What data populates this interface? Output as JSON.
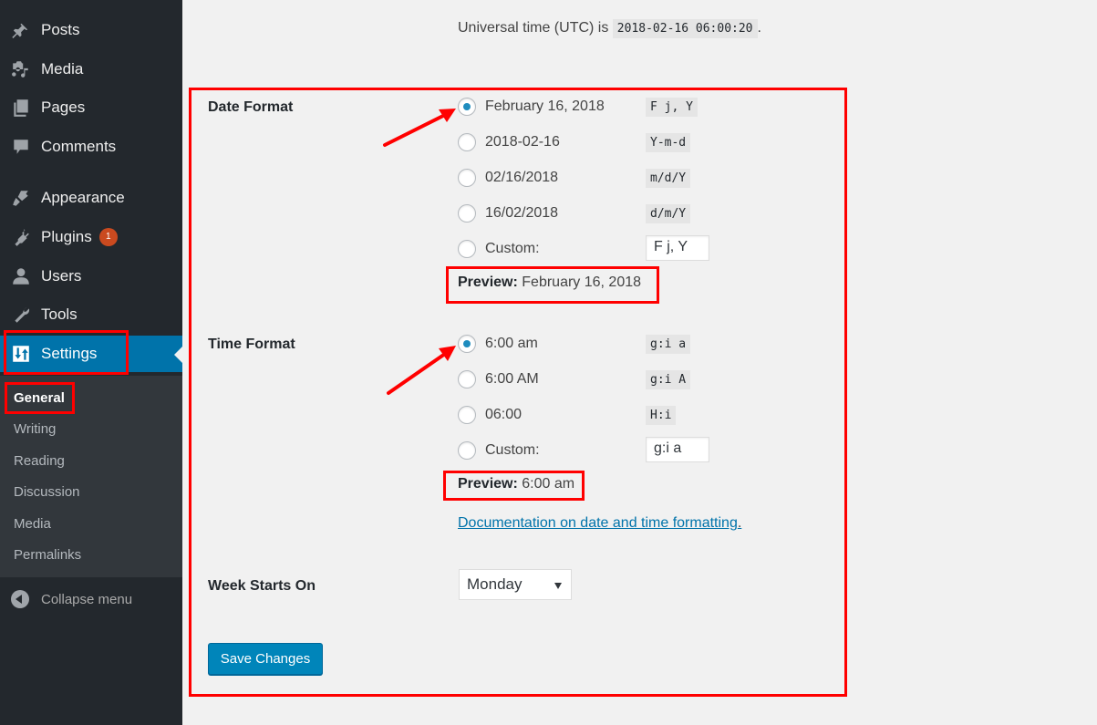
{
  "sidebar": {
    "items": [
      {
        "label": "Posts",
        "icon": "pushpin-icon"
      },
      {
        "label": "Media",
        "icon": "media-icon"
      },
      {
        "label": "Pages",
        "icon": "pages-icon"
      },
      {
        "label": "Comments",
        "icon": "comment-icon"
      },
      {
        "label": "Appearance",
        "icon": "paintbrush-icon"
      },
      {
        "label": "Plugins",
        "icon": "plugin-icon",
        "badge": "1"
      },
      {
        "label": "Users",
        "icon": "user-icon"
      },
      {
        "label": "Tools",
        "icon": "wrench-icon"
      },
      {
        "label": "Settings",
        "icon": "settings-icon",
        "active": true
      }
    ],
    "submenu": [
      "General",
      "Writing",
      "Reading",
      "Discussion",
      "Media",
      "Permalinks"
    ],
    "current_submenu": "General",
    "collapse_label": "Collapse menu"
  },
  "utc": {
    "label": "Universal time (UTC) is",
    "value": "2018-02-16 06:00:20",
    "suffix": "."
  },
  "date_format": {
    "label": "Date Format",
    "options": [
      {
        "label": "February 16, 2018",
        "format": "F j, Y",
        "checked": true
      },
      {
        "label": "2018-02-16",
        "format": "Y-m-d"
      },
      {
        "label": "02/16/2018",
        "format": "m/d/Y"
      },
      {
        "label": "16/02/2018",
        "format": "d/m/Y"
      }
    ],
    "custom_label": "Custom:",
    "custom_value": "F j, Y",
    "preview_label": "Preview:",
    "preview_value": "February 16, 2018"
  },
  "time_format": {
    "label": "Time Format",
    "options": [
      {
        "label": "6:00 am",
        "format": "g:i a",
        "checked": true
      },
      {
        "label": "6:00 AM",
        "format": "g:i A"
      },
      {
        "label": "06:00",
        "format": "H:i"
      }
    ],
    "custom_label": "Custom:",
    "custom_value": "g:i a",
    "preview_label": "Preview:",
    "preview_value": "6:00 am",
    "doc_link": "Documentation on date and time formatting",
    "doc_link_suffix": "."
  },
  "week_starts": {
    "label": "Week Starts On",
    "selected": "Monday"
  },
  "save_button": "Save Changes",
  "colors": {
    "sidebar_bg": "#23282d",
    "submenu_bg": "#32373c",
    "active_blue": "#0073aa",
    "button_blue": "#0085ba",
    "highlight_red": "#ff0000",
    "badge_orange": "#ca4a1f"
  }
}
